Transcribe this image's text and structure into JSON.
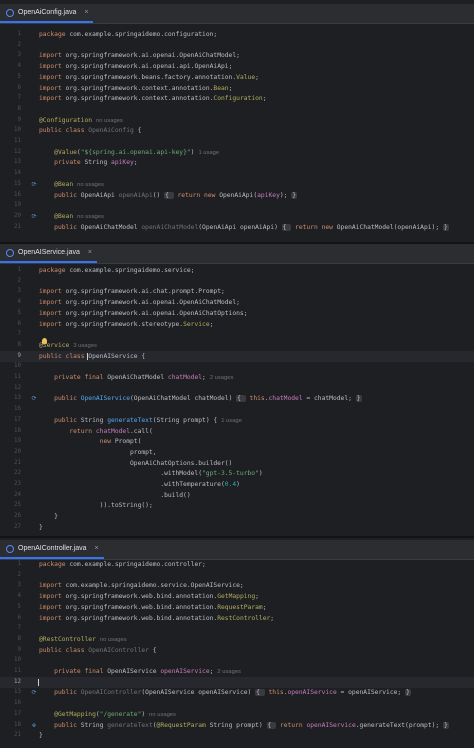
{
  "panes": [
    {
      "tab": "OpenAiConfig.java",
      "close": "×",
      "lines": [
        {
          "n": "1",
          "segs": [
            {
              "c": "kw",
              "t": "package "
            },
            {
              "c": "ty",
              "t": "com.example.springaidemo.configuration;"
            }
          ]
        },
        {
          "n": "2",
          "segs": []
        },
        {
          "n": "3",
          "segs": [
            {
              "c": "kw",
              "t": "import "
            },
            {
              "c": "ty",
              "t": "org.springframework.ai.openai.OpenAiChatModel;"
            }
          ]
        },
        {
          "n": "4",
          "segs": [
            {
              "c": "kw",
              "t": "import "
            },
            {
              "c": "ty",
              "t": "org.springframework.ai.openai.api.OpenAiApi;"
            }
          ]
        },
        {
          "n": "5",
          "segs": [
            {
              "c": "kw",
              "t": "import "
            },
            {
              "c": "ty",
              "t": "org.springframework.beans.factory.annotation."
            },
            {
              "c": "an",
              "t": "Value"
            },
            {
              "c": "ty",
              "t": ";"
            }
          ]
        },
        {
          "n": "6",
          "segs": [
            {
              "c": "kw",
              "t": "import "
            },
            {
              "c": "ty",
              "t": "org.springframework.context.annotation."
            },
            {
              "c": "an",
              "t": "Bean"
            },
            {
              "c": "ty",
              "t": ";"
            }
          ]
        },
        {
          "n": "7",
          "segs": [
            {
              "c": "kw",
              "t": "import "
            },
            {
              "c": "ty",
              "t": "org.springframework.context.annotation."
            },
            {
              "c": "an",
              "t": "Configuration"
            },
            {
              "c": "ty",
              "t": ";"
            }
          ]
        },
        {
          "n": "8",
          "segs": []
        },
        {
          "n": "9",
          "segs": [
            {
              "c": "an",
              "t": "@Configuration"
            },
            {
              "c": "hint",
              "t": "no usages"
            }
          ]
        },
        {
          "n": "10",
          "segs": [
            {
              "c": "kw",
              "t": "public class "
            },
            {
              "c": "unused",
              "t": "OpenAiConfig "
            },
            {
              "c": "ty",
              "t": "{"
            }
          ]
        },
        {
          "n": "11",
          "segs": []
        },
        {
          "n": "12",
          "segs": [
            {
              "c": "ty",
              "t": "    "
            },
            {
              "c": "an",
              "t": "@Value"
            },
            {
              "c": "ty",
              "t": "("
            },
            {
              "c": "st",
              "t": "\"${spring.ai.openai.api-key}\""
            },
            {
              "c": "ty",
              "t": ")"
            },
            {
              "c": "hint",
              "t": "1 usage"
            }
          ]
        },
        {
          "n": "13",
          "segs": [
            {
              "c": "kw",
              "t": "    private "
            },
            {
              "c": "ty",
              "t": "String "
            },
            {
              "c": "fd",
              "t": "apiKey"
            },
            {
              "c": "ty",
              "t": ";"
            }
          ]
        },
        {
          "n": "14",
          "segs": []
        },
        {
          "n": "15",
          "gut": "⟳",
          "segs": [
            {
              "c": "ty",
              "t": "    "
            },
            {
              "c": "an",
              "t": "@Bean"
            },
            {
              "c": "hint",
              "t": "no usages"
            }
          ]
        },
        {
          "n": "16",
          "segs": [
            {
              "c": "kw",
              "t": "    public "
            },
            {
              "c": "ty",
              "t": "OpenAiApi "
            },
            {
              "c": "unused",
              "t": "openAiApi"
            },
            {
              "c": "ty",
              "t": "() "
            },
            {
              "c": "fold",
              "t": "{ "
            },
            {
              "c": "kw",
              "t": " return new "
            },
            {
              "c": "ty",
              "t": "OpenAiApi("
            },
            {
              "c": "fd",
              "t": "apiKey"
            },
            {
              "c": "ty",
              "t": "); "
            },
            {
              "c": "fold",
              "t": "}"
            }
          ]
        },
        {
          "n": "19",
          "segs": []
        },
        {
          "n": "20",
          "gut": "⟳",
          "segs": [
            {
              "c": "ty",
              "t": "    "
            },
            {
              "c": "an",
              "t": "@Bean"
            },
            {
              "c": "hint",
              "t": "no usages"
            }
          ]
        },
        {
          "n": "21",
          "segs": [
            {
              "c": "kw",
              "t": "    public "
            },
            {
              "c": "ty",
              "t": "OpenAiChatModel "
            },
            {
              "c": "unused",
              "t": "openAiChatModel"
            },
            {
              "c": "ty",
              "t": "(OpenAiApi openAiApi) "
            },
            {
              "c": "fold",
              "t": "{ "
            },
            {
              "c": "kw",
              "t": " return new "
            },
            {
              "c": "ty",
              "t": "OpenAiChatModel(openAiApi); "
            },
            {
              "c": "fold",
              "t": "}"
            }
          ]
        }
      ]
    },
    {
      "tab": "OpenAIService.java",
      "close": "×",
      "lines": [
        {
          "n": "1",
          "segs": [
            {
              "c": "kw",
              "t": "package "
            },
            {
              "c": "ty",
              "t": "com.example.springaidemo.service;"
            }
          ]
        },
        {
          "n": "2",
          "segs": []
        },
        {
          "n": "3",
          "segs": [
            {
              "c": "kw",
              "t": "import "
            },
            {
              "c": "ty",
              "t": "org.springframework.ai.chat.prompt.Prompt;"
            }
          ]
        },
        {
          "n": "4",
          "segs": [
            {
              "c": "kw",
              "t": "import "
            },
            {
              "c": "ty",
              "t": "org.springframework.ai.openai.OpenAiChatModel;"
            }
          ]
        },
        {
          "n": "5",
          "segs": [
            {
              "c": "kw",
              "t": "import "
            },
            {
              "c": "ty",
              "t": "org.springframework.ai.openai.OpenAiChatOptions;"
            }
          ]
        },
        {
          "n": "6",
          "segs": [
            {
              "c": "kw",
              "t": "import "
            },
            {
              "c": "ty",
              "t": "org.springframework.stereotype."
            },
            {
              "c": "an",
              "t": "Service"
            },
            {
              "c": "ty",
              "t": ";"
            }
          ]
        },
        {
          "n": "7",
          "segs": []
        },
        {
          "n": "8",
          "bulb": true,
          "segs": [
            {
              "c": "an",
              "t": "@Service"
            },
            {
              "c": "hint",
              "t": "3 usages"
            }
          ]
        },
        {
          "n": "9",
          "cur": true,
          "caret": true,
          "segs": [
            {
              "c": "kw",
              "t": "public class "
            },
            {
              "c": "ty",
              "t": "OpenAIService "
            },
            {
              "c": "ty",
              "t": "{"
            }
          ]
        },
        {
          "n": "10",
          "segs": []
        },
        {
          "n": "11",
          "segs": [
            {
              "c": "kw",
              "t": "    private final "
            },
            {
              "c": "ty",
              "t": "OpenAiChatModel "
            },
            {
              "c": "fd",
              "t": "chatModel"
            },
            {
              "c": "ty",
              "t": ";"
            },
            {
              "c": "hint",
              "t": "2 usages"
            }
          ]
        },
        {
          "n": "12",
          "segs": []
        },
        {
          "n": "13",
          "gut": "⟳",
          "segs": [
            {
              "c": "kw",
              "t": "    public "
            },
            {
              "c": "fn",
              "t": "OpenAIService"
            },
            {
              "c": "ty",
              "t": "(OpenAiChatModel chatModel) "
            },
            {
              "c": "fold",
              "t": "{ "
            },
            {
              "c": "kw",
              "t": " this"
            },
            {
              "c": "ty",
              "t": "."
            },
            {
              "c": "fd",
              "t": "chatModel"
            },
            {
              "c": "ty",
              "t": " = chatModel; "
            },
            {
              "c": "fold",
              "t": "}"
            }
          ]
        },
        {
          "n": "16",
          "segs": []
        },
        {
          "n": "17",
          "segs": [
            {
              "c": "kw",
              "t": "    public "
            },
            {
              "c": "ty",
              "t": "String "
            },
            {
              "c": "fn",
              "t": "generateText"
            },
            {
              "c": "ty",
              "t": "(String prompt) {"
            },
            {
              "c": "hint",
              "t": "1 usage"
            }
          ]
        },
        {
          "n": "18",
          "segs": [
            {
              "c": "kw",
              "t": "        return "
            },
            {
              "c": "fd",
              "t": "chatModel"
            },
            {
              "c": "ty",
              "t": ".call("
            }
          ]
        },
        {
          "n": "19",
          "segs": [
            {
              "c": "kw",
              "t": "                new "
            },
            {
              "c": "ty",
              "t": "Prompt("
            }
          ]
        },
        {
          "n": "20",
          "segs": [
            {
              "c": "ty",
              "t": "                        prompt,"
            }
          ]
        },
        {
          "n": "21",
          "segs": [
            {
              "c": "ty",
              "t": "                        OpenAiChatOptions.builder()"
            }
          ]
        },
        {
          "n": "22",
          "segs": [
            {
              "c": "ty",
              "t": "                                .withModel("
            },
            {
              "c": "st",
              "t": "\"gpt-3.5-turbo\""
            },
            {
              "c": "ty",
              "t": ")"
            }
          ]
        },
        {
          "n": "23",
          "segs": [
            {
              "c": "ty",
              "t": "                                .withTemperature("
            },
            {
              "c": "nm",
              "t": "0.4"
            },
            {
              "c": "ty",
              "t": ")"
            }
          ]
        },
        {
          "n": "24",
          "segs": [
            {
              "c": "ty",
              "t": "                                .build()"
            }
          ]
        },
        {
          "n": "25",
          "segs": [
            {
              "c": "ty",
              "t": "                )).toString();"
            }
          ]
        },
        {
          "n": "26",
          "segs": [
            {
              "c": "ty",
              "t": "    }"
            }
          ]
        },
        {
          "n": "27",
          "segs": [
            {
              "c": "ty",
              "t": "}"
            }
          ]
        }
      ]
    },
    {
      "tab": "OpenAIController.java",
      "close": "×",
      "lines": [
        {
          "n": "1",
          "segs": [
            {
              "c": "kw",
              "t": "package "
            },
            {
              "c": "ty",
              "t": "com.example.springaidemo.controller;"
            }
          ]
        },
        {
          "n": "2",
          "segs": []
        },
        {
          "n": "3",
          "segs": [
            {
              "c": "kw",
              "t": "import "
            },
            {
              "c": "ty",
              "t": "com.example.springaidemo.service.OpenAIService;"
            }
          ]
        },
        {
          "n": "4",
          "segs": [
            {
              "c": "kw",
              "t": "import "
            },
            {
              "c": "ty",
              "t": "org.springframework.web.bind.annotation."
            },
            {
              "c": "an",
              "t": "GetMapping"
            },
            {
              "c": "ty",
              "t": ";"
            }
          ]
        },
        {
          "n": "5",
          "segs": [
            {
              "c": "kw",
              "t": "import "
            },
            {
              "c": "ty",
              "t": "org.springframework.web.bind.annotation."
            },
            {
              "c": "an",
              "t": "RequestParam"
            },
            {
              "c": "ty",
              "t": ";"
            }
          ]
        },
        {
          "n": "6",
          "segs": [
            {
              "c": "kw",
              "t": "import "
            },
            {
              "c": "ty",
              "t": "org.springframework.web.bind.annotation."
            },
            {
              "c": "an",
              "t": "RestController"
            },
            {
              "c": "ty",
              "t": ";"
            }
          ]
        },
        {
          "n": "7",
          "segs": []
        },
        {
          "n": "8",
          "segs": [
            {
              "c": "an",
              "t": "@RestController"
            },
            {
              "c": "hint",
              "t": "no usages"
            }
          ]
        },
        {
          "n": "9",
          "segs": [
            {
              "c": "kw",
              "t": "public class "
            },
            {
              "c": "unused",
              "t": "OpenAIController "
            },
            {
              "c": "ty",
              "t": "{"
            }
          ]
        },
        {
          "n": "10",
          "segs": []
        },
        {
          "n": "11",
          "segs": [
            {
              "c": "kw",
              "t": "    private final "
            },
            {
              "c": "ty",
              "t": "OpenAIService "
            },
            {
              "c": "fd",
              "t": "openAIService"
            },
            {
              "c": "ty",
              "t": ";"
            },
            {
              "c": "hint",
              "t": "2 usages"
            }
          ]
        },
        {
          "n": "12",
          "cur": true,
          "caret": true,
          "segs": []
        },
        {
          "n": "13",
          "gut": "⟳",
          "segs": [
            {
              "c": "kw",
              "t": "    public "
            },
            {
              "c": "unused",
              "t": "OpenAIController"
            },
            {
              "c": "ty",
              "t": "(OpenAIService openAIService) "
            },
            {
              "c": "fold",
              "t": "{ "
            },
            {
              "c": "kw",
              "t": " this"
            },
            {
              "c": "ty",
              "t": "."
            },
            {
              "c": "fd",
              "t": "openAIService"
            },
            {
              "c": "ty",
              "t": " = openAIService; "
            },
            {
              "c": "fold",
              "t": "}"
            }
          ]
        },
        {
          "n": "16",
          "segs": []
        },
        {
          "n": "17",
          "segs": [
            {
              "c": "ty",
              "t": "    "
            },
            {
              "c": "an",
              "t": "@GetMapping"
            },
            {
              "c": "ty",
              "t": "("
            },
            {
              "c": "st",
              "t": "\"/generate\""
            },
            {
              "c": "ty",
              "t": ")"
            },
            {
              "c": "hint",
              "t": "no usages"
            }
          ]
        },
        {
          "n": "18",
          "gut": "⊕",
          "segs": [
            {
              "c": "kw",
              "t": "    public "
            },
            {
              "c": "ty",
              "t": "String "
            },
            {
              "c": "unused",
              "t": "generateText"
            },
            {
              "c": "ty",
              "t": "("
            },
            {
              "c": "an",
              "t": "@RequestParam"
            },
            {
              "c": "ty",
              "t": " String prompt) "
            },
            {
              "c": "fold",
              "t": "{ "
            },
            {
              "c": "kw",
              "t": " return "
            },
            {
              "c": "fd",
              "t": "openAIService"
            },
            {
              "c": "ty",
              "t": ".generateText(prompt); "
            },
            {
              "c": "fold",
              "t": "}"
            }
          ]
        },
        {
          "n": "21",
          "segs": [
            {
              "c": "ty",
              "t": "}"
            }
          ]
        }
      ]
    }
  ]
}
